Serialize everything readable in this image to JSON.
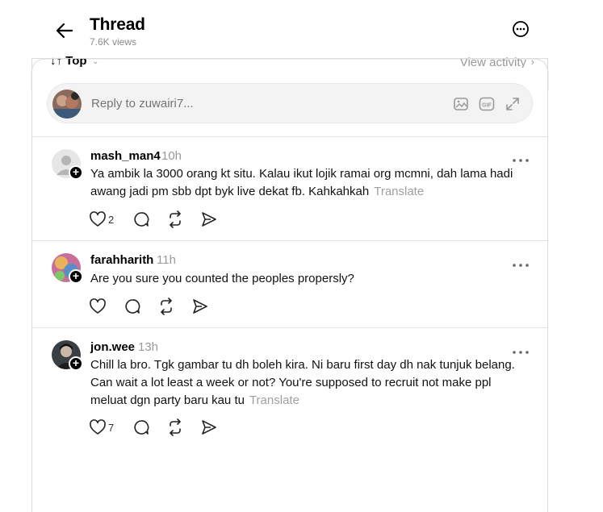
{
  "header": {
    "title": "Thread",
    "views": "7.6K views"
  },
  "sort": {
    "label": "↓↑ Top",
    "view_activity": "View activity"
  },
  "reply": {
    "placeholder": "Reply to zuwairi7..."
  },
  "posts": [
    {
      "username": "mash_man4",
      "time": "10h",
      "text": "Ya ambik la 3000 orang kt situ. Kalau ikut lojik ramai org mcmni, dah lama hadi awang jadi pm sbb dpt byk live dekat fb. Kahkahkah",
      "translate": "Translate",
      "likes": "2"
    },
    {
      "username": "farahharith",
      "time": "11h",
      "text": "Are you sure you counted the peoples propersly?",
      "translate": "",
      "likes": ""
    },
    {
      "username": "jon.wee",
      "time": "13h",
      "text": "Chill la bro. Tgk gambar tu dh boleh kira. Ni baru first day dh nak tunjuk belang. Can wait a lot least a week or not? You're supposed to recruit not make ppl meluat dgn party baru kau tu",
      "translate": "Translate",
      "likes": "7"
    }
  ],
  "icons": {
    "back": "arrow-left-icon",
    "more": "more-circle-icon",
    "image": "image-icon",
    "gif": "gif-icon",
    "expand": "expand-icon",
    "like": "heart-icon",
    "comment": "comment-icon",
    "repost": "repost-icon",
    "share": "send-icon"
  },
  "colors": {
    "muted": "#9a9a9a",
    "border": "#dcdcdc",
    "reply_bg": "#f3f3f3"
  }
}
